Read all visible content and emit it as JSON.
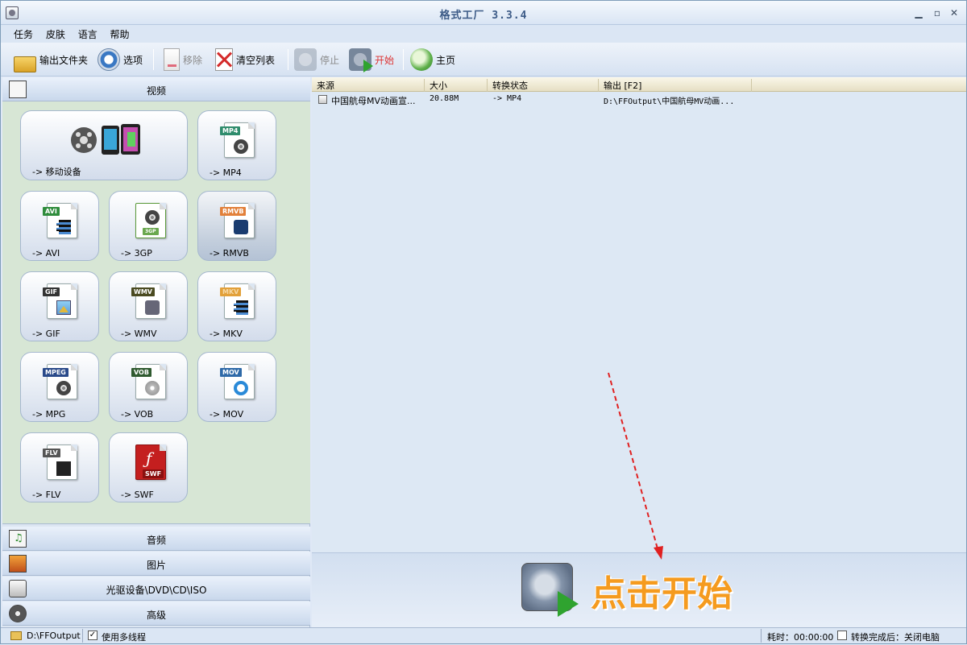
{
  "window": {
    "title": "格式工厂 3.3.4"
  },
  "menu": [
    "任务",
    "皮肤",
    "语言",
    "帮助"
  ],
  "toolbar": {
    "output_folder": "输出文件夹",
    "options": "选项",
    "remove": "移除",
    "clear_list": "清空列表",
    "stop": "停止",
    "start": "开始",
    "home": "主页"
  },
  "categories": {
    "video": "视频",
    "audio": "音频",
    "image": "图片",
    "disc": "光驱设备\\DVD\\CD\\ISO",
    "advanced": "高级"
  },
  "formats": [
    {
      "label": "-> 移动设备",
      "tag": ""
    },
    {
      "label": "-> MP4",
      "tag": "MP4"
    },
    {
      "label": "-> AVI",
      "tag": "AVI"
    },
    {
      "label": "-> 3GP",
      "tag": "3GP"
    },
    {
      "label": "-> RMVB",
      "tag": "RMVB"
    },
    {
      "label": "-> GIF",
      "tag": "GIF"
    },
    {
      "label": "-> WMV",
      "tag": "WMV"
    },
    {
      "label": "-> MKV",
      "tag": "MKV"
    },
    {
      "label": "-> MPG",
      "tag": "MPEG"
    },
    {
      "label": "-> VOB",
      "tag": "VOB"
    },
    {
      "label": "-> MOV",
      "tag": "MOV"
    },
    {
      "label": "-> FLV",
      "tag": "FLV"
    },
    {
      "label": "-> SWF",
      "tag": "SWF"
    }
  ],
  "list": {
    "columns": [
      "来源",
      "大小",
      "转换状态",
      "输出 [F2]"
    ],
    "rows": [
      {
        "source": "中国航母MV动画宣...",
        "size": "20.88M",
        "status": "-> MP4",
        "output": "D:\\FFOutput\\中国航母MV动画..."
      }
    ]
  },
  "start_area": {
    "label": "点击开始"
  },
  "status": {
    "output_path": "D:\\FFOutput",
    "multithread": "使用多线程",
    "multithread_checked": "✓",
    "elapsed": "耗时：00:00:00",
    "after_convert": "转换完成后：关闭电脑"
  },
  "colors": {
    "accent_orange": "#f59b1f",
    "arrow_red": "#e02020",
    "start_green": "#2fa32f"
  }
}
